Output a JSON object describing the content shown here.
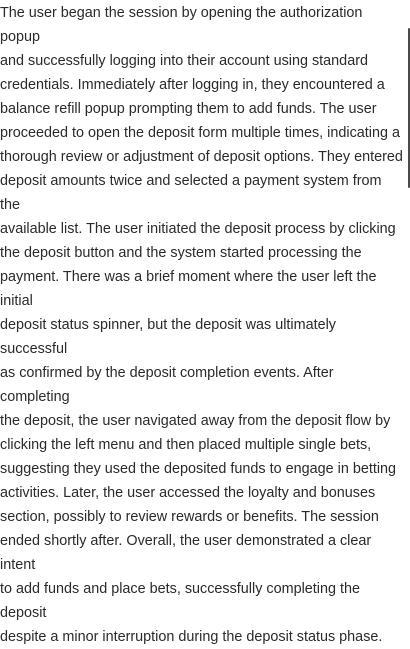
{
  "summary": {
    "text": "The user began the session by opening the authorization popup\nand successfully logging into their account using standard\ncredentials. Immediately after logging in, they encountered a\nbalance refill popup prompting them to add funds. The user\nproceeded to open the deposit form multiple times, indicating a\nthorough review or adjustment of deposit options. They entered\ndeposit amounts twice and selected a payment system from the\navailable list. The user initiated the deposit process by clicking\nthe deposit button and the system started processing the\npayment. There was a brief moment where the user left the initial\ndeposit status spinner, but the deposit was ultimately successful\nas confirmed by the deposit completion events. After completing\nthe deposit, the user navigated away from the deposit flow by\nclicking the left menu and then placed multiple single bets,\nsuggesting they used the deposited funds to engage in betting\nactivities. Later, the user accessed the loyalty and bonuses\nsection, possibly to review rewards or benefits. The session\nended shortly after. Overall, the user demonstrated a clear intent\nto add funds and place bets, successfully completing the deposit\ndespite a minor interruption during the deposit status phase."
  },
  "colors": {
    "text": "#2a2a2a",
    "background": "#ffffff",
    "scrollbar": "#4a4a4a"
  }
}
